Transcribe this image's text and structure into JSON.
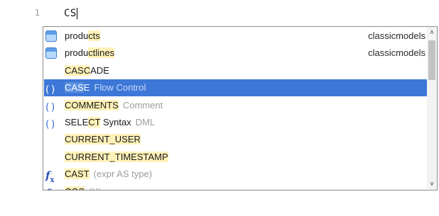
{
  "editor": {
    "line_number": "1",
    "code": "CS"
  },
  "completion": {
    "items": [
      {
        "icon": "table-icon",
        "pre": "produ",
        "hl": "cts",
        "post": "",
        "hint": "",
        "right": "classicmodels"
      },
      {
        "icon": "table-icon",
        "pre": "produ",
        "hl": "ctlines",
        "post": "",
        "hint": "",
        "right": "classicmodels"
      },
      {
        "icon": "",
        "pre": "",
        "hl": "CASC",
        "post": "ADE",
        "hint": "",
        "right": ""
      },
      {
        "icon": "paren-icon",
        "pre": "",
        "hl": "CAS",
        "post": "E",
        "hint": "Flow Control",
        "right": ""
      },
      {
        "icon": "paren-icon",
        "pre": "",
        "hl": "COMMENTS",
        "post": "",
        "hint": "Comment",
        "right": ""
      },
      {
        "icon": "paren-icon",
        "pre": "SELE",
        "hl": "CT",
        "post": " Syntax",
        "hint": "DML",
        "right": ""
      },
      {
        "icon": "",
        "pre": "",
        "hl": "CURRENT_USER",
        "post": "",
        "hint": "",
        "right": ""
      },
      {
        "icon": "",
        "pre": "",
        "hl": "CURRENT_TIMESTAMP",
        "post": "",
        "hint": "",
        "right": ""
      },
      {
        "icon": "fx-icon",
        "pre": "",
        "hl": "CAST",
        "post": "",
        "hint": "(expr AS type)",
        "right": ""
      },
      {
        "icon": "fx-icon",
        "pre": "",
        "hl": "COS",
        "post": "",
        "hint": "(X)",
        "right": ""
      }
    ],
    "selected_index": 3
  },
  "scrollbar": {
    "up_arrow": "∧",
    "down_arrow": "∨"
  }
}
